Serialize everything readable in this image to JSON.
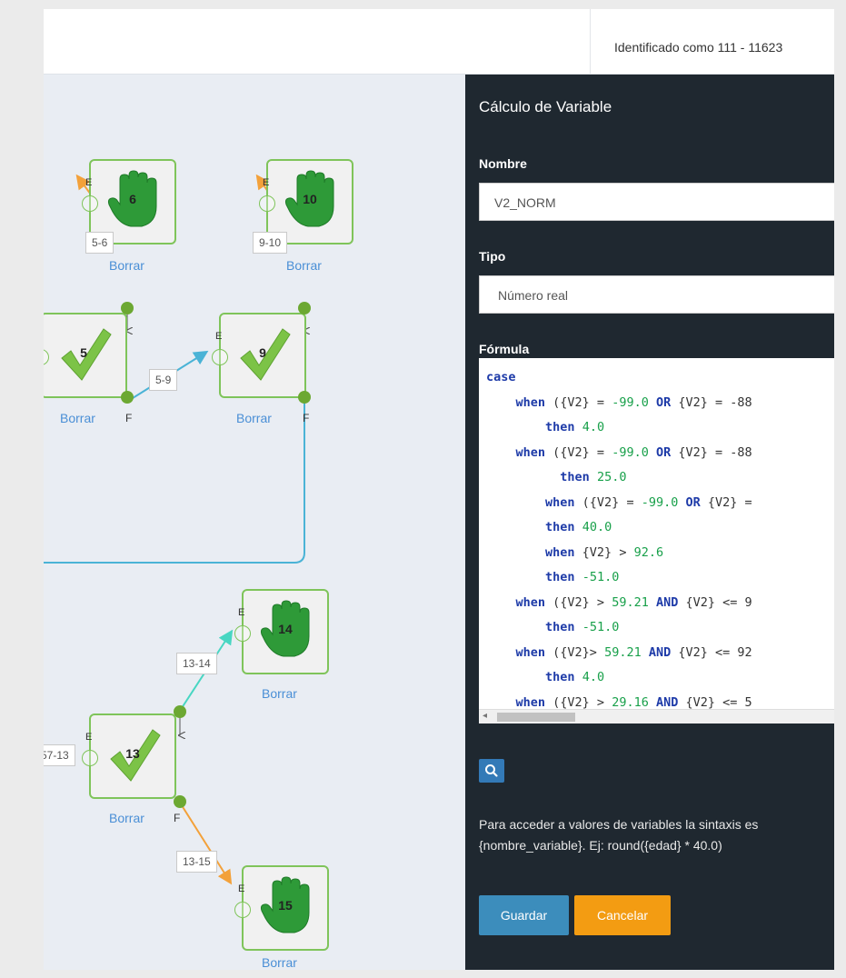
{
  "header": {
    "user_label": "Identificado como 111 - 11623"
  },
  "canvas": {
    "nodes": [
      {
        "id": "6",
        "icon": "stop-hand-icon",
        "delete_label": "Borrar"
      },
      {
        "id": "10",
        "icon": "stop-hand-icon",
        "delete_label": "Borrar"
      },
      {
        "id": "5",
        "icon": "checkmark-icon",
        "delete_label": "Borrar"
      },
      {
        "id": "9",
        "icon": "checkmark-icon",
        "delete_label": "Borrar"
      },
      {
        "id": "14",
        "icon": "stop-hand-icon",
        "delete_label": "Borrar"
      },
      {
        "id": "13",
        "icon": "checkmark-icon",
        "delete_label": "Borrar"
      },
      {
        "id": "15",
        "icon": "stop-hand-icon",
        "delete_label": "Borrar"
      }
    ],
    "edges": [
      "5-6",
      "9-10",
      "5-9",
      "13-14",
      "57-13",
      "13-15"
    ],
    "port_entry_label": "E",
    "port_exit_label": "F"
  },
  "panel": {
    "title": "Cálculo de Variable",
    "name_label": "Nombre",
    "name_value": "V2_NORM",
    "type_label": "Tipo",
    "type_value": "Número real",
    "formula_label": "Fórmula",
    "help_text": "Para acceder a valores de variables la sintaxis es {nombre_variable}. Ej: round({edad} * 40.0)",
    "save_label": "Guardar",
    "cancel_label": "Cancelar"
  },
  "formula_lines": [
    "case",
    "    when ({V2} = -99.0 OR {V2} = -88",
    "        then 4.0",
    "    when ({V2} = -99.0 OR {V2} = -88",
    "          then 25.0",
    "        when ({V2} = -99.0 OR {V2} =",
    "        then 40.0",
    "        when {V2} > 92.6",
    "        then -51.0",
    "    when ({V2} > 59.21 AND {V2} <= 9",
    "        then -51.0",
    "    when ({V2}> 59.21 AND {V2} <= 92",
    "        then 4.0",
    "    when ({V2} > 29.16 AND {V2} <= 5"
  ],
  "colors": {
    "panel_bg": "#1f2830",
    "save": "#3c8dbc",
    "cancel": "#f39c12",
    "node_border": "#7fc45a",
    "edge_orange": "#f3a13a",
    "edge_blue": "#4ab3d6",
    "edge_teal": "#48d6c2"
  }
}
